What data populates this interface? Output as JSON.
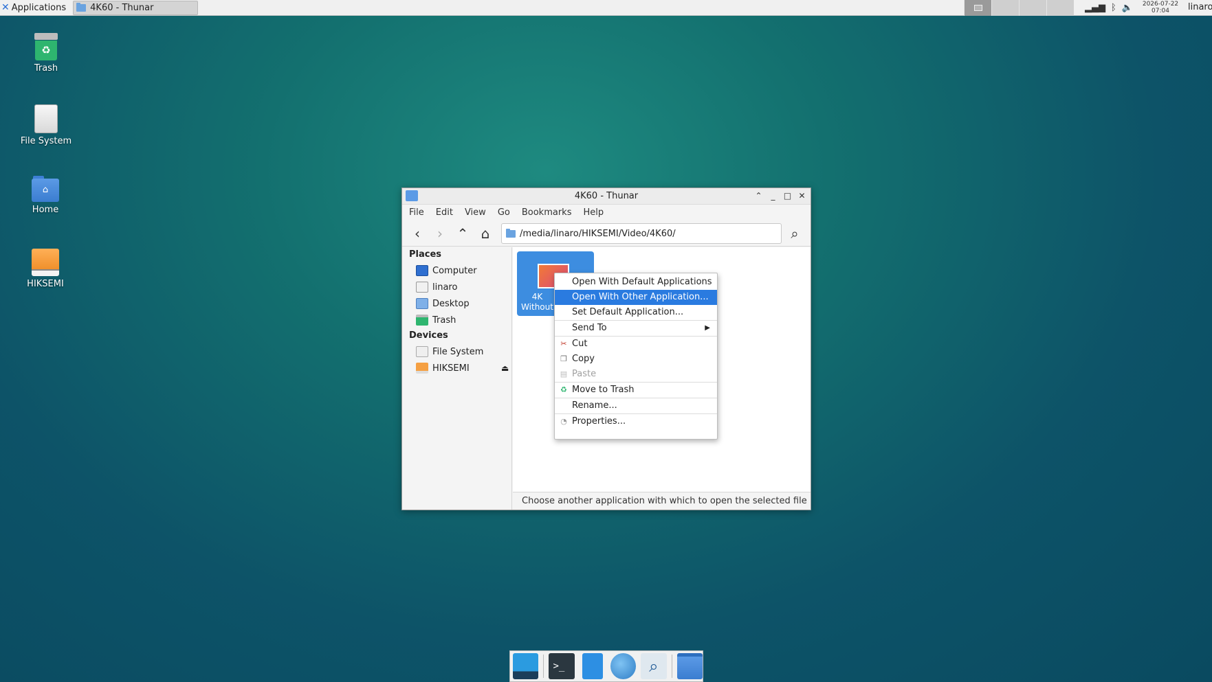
{
  "top_panel": {
    "applications_label": "Applications",
    "task_label": "4K60 - Thunar",
    "clock_date": "2026-07-22",
    "clock_time": "07:04",
    "user": "linaro"
  },
  "desktop": {
    "icons": [
      {
        "label": "Trash",
        "icon": "trash-icon"
      },
      {
        "label": "File System",
        "icon": "drive-icon"
      },
      {
        "label": "Home",
        "icon": "home-folder-icon"
      },
      {
        "label": "HIKSEMI",
        "icon": "usb-drive-icon"
      }
    ]
  },
  "window": {
    "title": "4K60 - Thunar",
    "menu": [
      "File",
      "Edit",
      "View",
      "Go",
      "Bookmarks",
      "Help"
    ],
    "location": "/media/linaro/HIKSEMI/Video/4K60/",
    "sidebar": {
      "places_label": "Places",
      "places": [
        "Computer",
        "linaro",
        "Desktop",
        "Trash"
      ],
      "devices_label": "Devices",
      "devices": [
        "File System",
        "HIKSEMI"
      ]
    },
    "file": {
      "name_line1": "4K",
      "name_line2": "Without"
    },
    "status": "Choose another application with which to open the selected file"
  },
  "context_menu": {
    "items": [
      "Open With Default Applications",
      "Open With Other Application...",
      "Set Default Application...",
      "Send To",
      "Cut",
      "Copy",
      "Paste",
      "Move to Trash",
      "Rename...",
      "Properties..."
    ],
    "highlighted": "Open With Other Application...",
    "disabled": [
      "Paste"
    ]
  },
  "colors": {
    "selection": "#2a7be0",
    "desktop": "#0f5a6a"
  }
}
